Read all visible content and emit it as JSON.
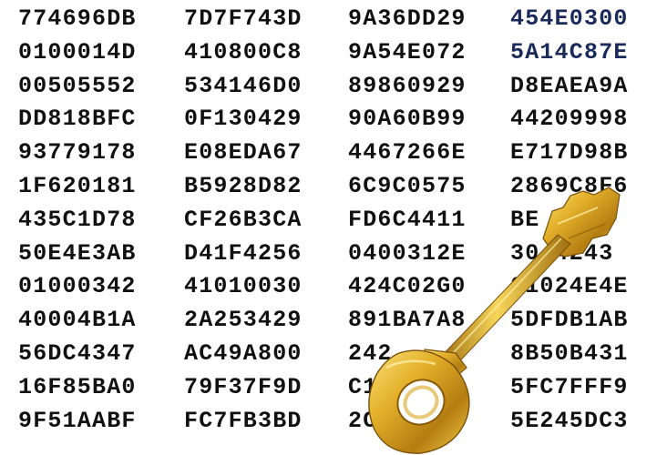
{
  "hex_rows": [
    [
      "774696DB",
      "7D7F743D",
      "9A36DD29",
      "454E0300"
    ],
    [
      "0100014D",
      "410800C8",
      "9A54E072",
      "5A14C87E"
    ],
    [
      "00505552",
      "534146D0",
      "89860929",
      "D8EAEA9A"
    ],
    [
      "DD818BFC",
      "0F130429",
      "90A60B99",
      "44209998"
    ],
    [
      "93779178",
      "E08EDA67",
      "4467266E",
      "E717D98B"
    ],
    [
      "1F620181",
      "B5928D82",
      "6C9C0575",
      "2869C8F6"
    ],
    [
      "435C1D78",
      "CF26B3CA",
      "FD6C4411",
      "BE  B6"
    ],
    [
      "50E4E3AB",
      "D41F4256",
      "0400312E",
      "30  4243"
    ],
    [
      "01000342",
      "41010030",
      "424C02G0",
      "01024E4E"
    ],
    [
      "40004B1A",
      "2A253429",
      "891BA7A8",
      "5DFDB1AB"
    ],
    [
      "56DC4347",
      "AC49A800",
      "242",
      "8B50B431"
    ],
    [
      "16F85BA0",
      "79F37F9D",
      "C1D",
      "5FC7FFF9"
    ],
    [
      "9F51AABF",
      "FC7FB3BD",
      "2C9C0100",
      "5E245DC3"
    ]
  ],
  "colors": {
    "text": "#111111",
    "key_gold_light": "#f7d34a",
    "key_gold_mid": "#d9a51c",
    "key_gold_dark": "#8a5a0a"
  },
  "image_subject": "gold-key-over-hex-dump"
}
